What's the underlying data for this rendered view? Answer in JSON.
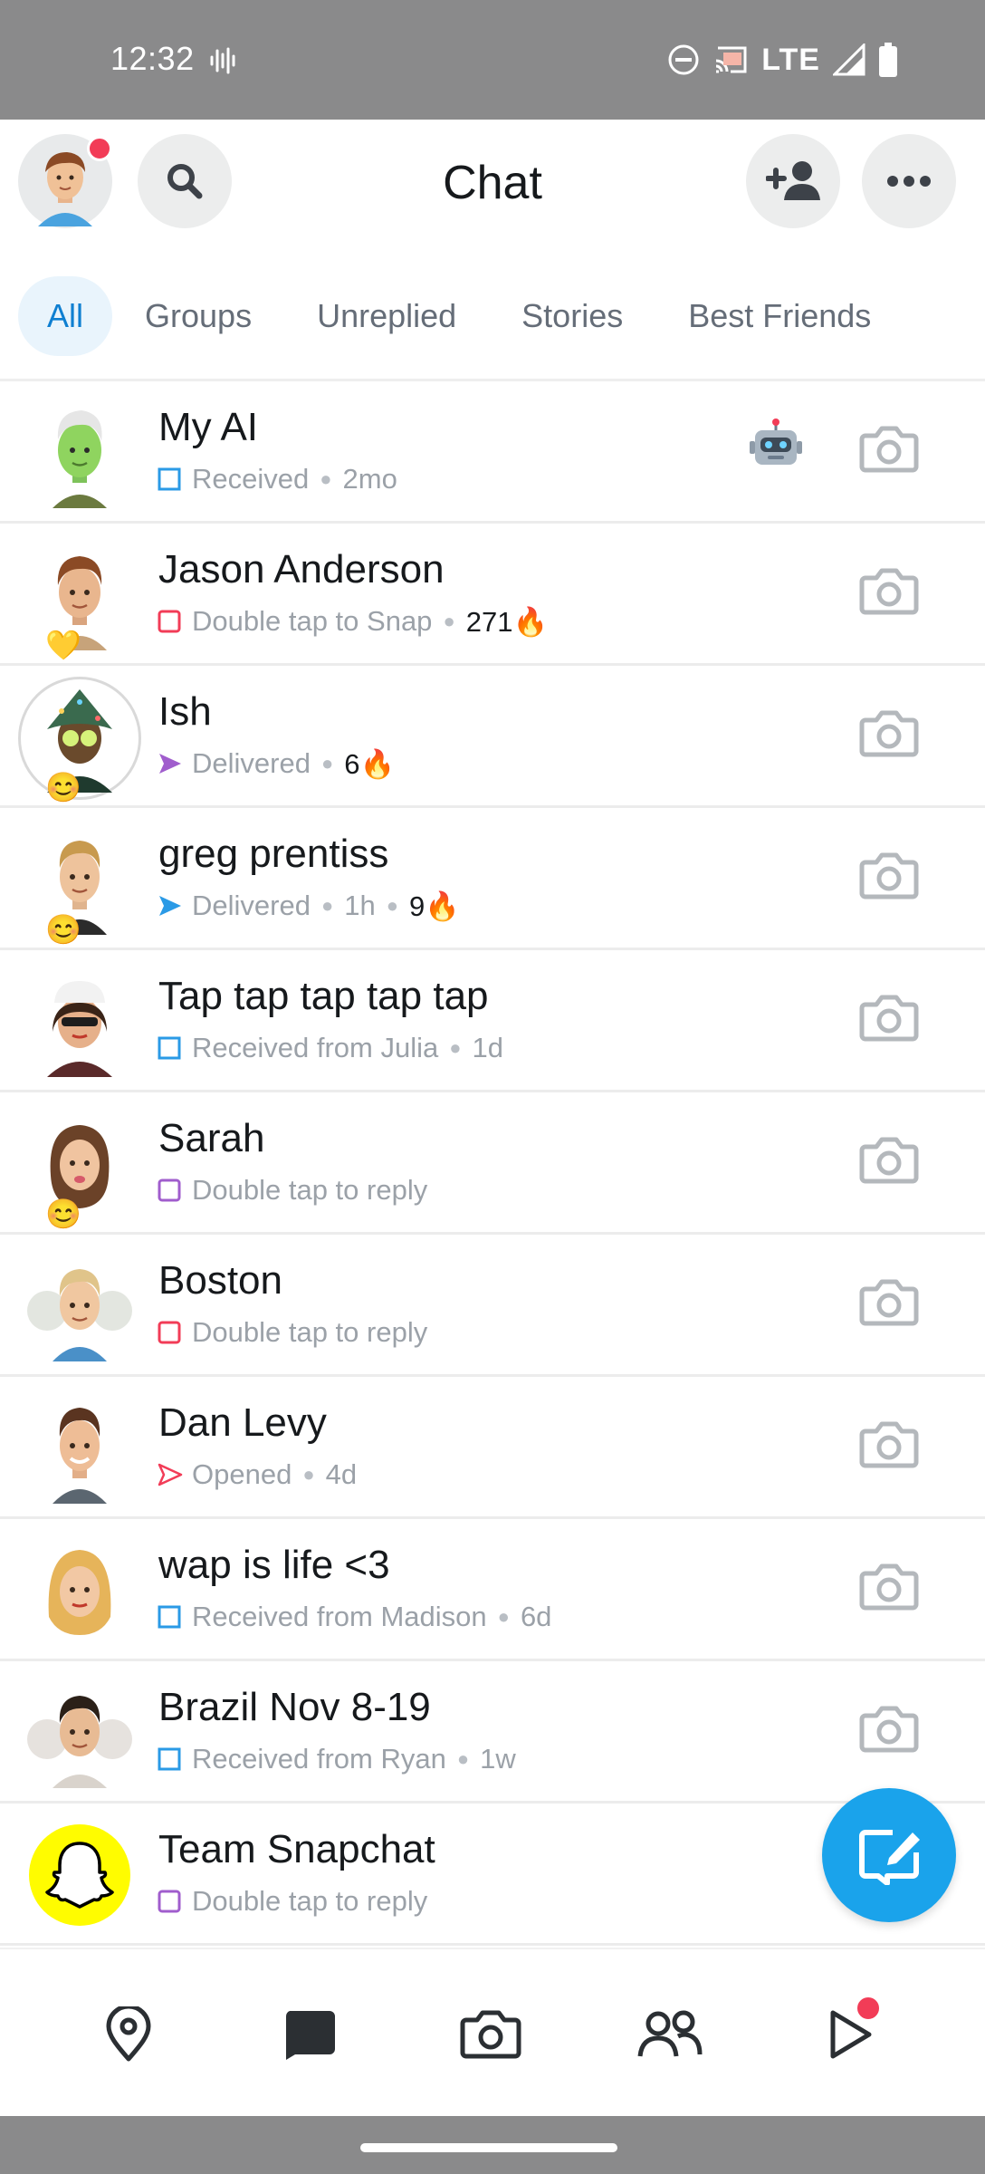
{
  "status_bar": {
    "time": "12:32",
    "network": "LTE"
  },
  "header": {
    "title": "Chat"
  },
  "tabs": [
    {
      "label": "All",
      "active": true
    },
    {
      "label": "Groups",
      "active": false
    },
    {
      "label": "Unreplied",
      "active": false
    },
    {
      "label": "Stories",
      "active": false
    },
    {
      "label": "Best Friends",
      "active": false
    }
  ],
  "chats": [
    {
      "name": "My AI",
      "status": "Received",
      "time": "2mo",
      "streak": "",
      "icon": "received-chat-icon",
      "badge": "robot-icon"
    },
    {
      "name": "Jason Anderson",
      "status": "Double tap to Snap",
      "time": "",
      "streak": "271🔥",
      "icon": "unopened-snap-icon",
      "friend_emoji": "💛"
    },
    {
      "name": "Ish",
      "status": "Delivered",
      "time": "",
      "streak": "6🔥",
      "icon": "delivered-video-icon",
      "friend_emoji": "😊"
    },
    {
      "name": "greg prentiss",
      "status": "Delivered",
      "time": "1h",
      "streak": "9🔥",
      "icon": "delivered-chat-icon",
      "friend_emoji": "😊"
    },
    {
      "name": "Tap tap tap tap tap",
      "status": "Received from Julia",
      "time": "1d",
      "streak": "",
      "icon": "received-chat-icon"
    },
    {
      "name": "Sarah",
      "status": "Double tap to reply",
      "time": "",
      "streak": "",
      "icon": "reply-video-icon",
      "friend_emoji": "😊"
    },
    {
      "name": "Boston",
      "status": "Double tap to reply",
      "time": "",
      "streak": "",
      "icon": "reply-snap-icon"
    },
    {
      "name": "Dan Levy",
      "status": "Opened",
      "time": "4d",
      "streak": "",
      "icon": "opened-snap-icon"
    },
    {
      "name": "wap is life <3",
      "status": "Received from Madison",
      "time": "6d",
      "streak": "",
      "icon": "received-chat-icon"
    },
    {
      "name": "Brazil Nov 8-19",
      "status": "Received from Ryan",
      "time": "1w",
      "streak": "",
      "icon": "received-chat-icon"
    },
    {
      "name": "Team Snapchat",
      "status": "Double tap to reply",
      "time": "",
      "streak": "",
      "icon": "reply-video-icon"
    }
  ],
  "colors": {
    "accent_blue": "#1aa3eb",
    "snap_red": "#f23c57",
    "chat_blue": "#2a9ae6",
    "video_purple": "#a05dcd",
    "snapchat_yellow": "#fffc00"
  },
  "bottom_nav": [
    "map-icon",
    "chat-icon",
    "camera-icon",
    "friends-icon",
    "stories-icon"
  ]
}
